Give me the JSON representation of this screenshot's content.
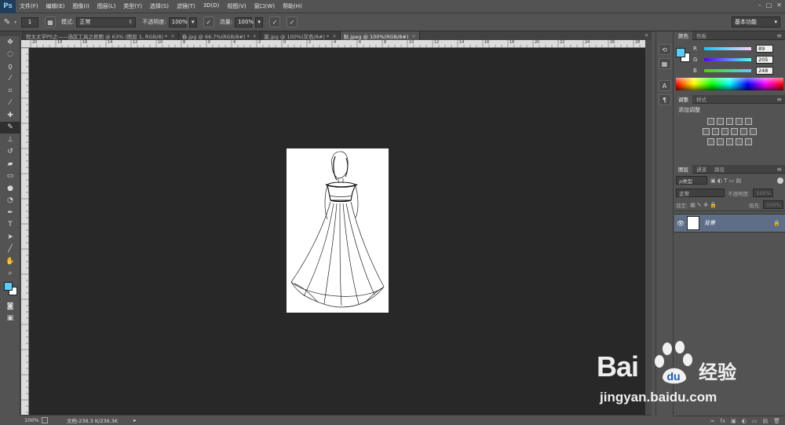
{
  "app": {
    "logo": "Ps"
  },
  "menu": [
    "文件(F)",
    "编辑(E)",
    "图像(I)",
    "图层(L)",
    "类型(Y)",
    "选择(S)",
    "滤镜(T)",
    "3D(D)",
    "视图(V)",
    "窗口(W)",
    "帮助(H)"
  ],
  "window_buttons": [
    "–",
    "□",
    "✕"
  ],
  "options": {
    "brush_size": "1",
    "mode_label": "模式:",
    "mode_value": "正常",
    "opacity_label": "不透明度:",
    "opacity_value": "100%",
    "flow_label": "流量:",
    "flow_value": "100%",
    "workspace": "基本功能"
  },
  "tabs": [
    {
      "label": "程太太学PS之——选区工具之抠图 @ 63% (图层 1, RGB/8) *",
      "close": "×"
    },
    {
      "label": "春.jpg @ 66.7%(RGB/8#) *",
      "close": "×"
    },
    {
      "label": "夏.jpg @ 100%(灰色/8#) *",
      "close": "×"
    },
    {
      "label": "秋.jpeg @ 100%(RGB/8#)",
      "close": "×"
    }
  ],
  "ruler_top_labels": [
    "20",
    "18",
    "16",
    "14",
    "12",
    "10",
    "8",
    "6",
    "4",
    "2",
    "0",
    "2",
    "4",
    "6",
    "8",
    "10",
    "12",
    "14",
    "16",
    "18",
    "20",
    "22",
    "24",
    "26",
    "28"
  ],
  "status": {
    "zoom": "100%",
    "doc": "文档:236.3 K/236.3K"
  },
  "color_panel": {
    "tabs": [
      "颜色",
      "色板"
    ],
    "sliders": [
      {
        "label": "R",
        "value": "89"
      },
      {
        "label": "G",
        "value": "205"
      },
      {
        "label": "B",
        "value": "248"
      }
    ],
    "foreground": "#59cdf8"
  },
  "adjust_panel": {
    "tabs": [
      "调整",
      "样式"
    ],
    "title": "添加调整"
  },
  "layers_panel": {
    "tabs": [
      "图层",
      "通道",
      "路径"
    ],
    "filter": "ρ类型",
    "blend": "正常",
    "opacity_label": "不透明度:",
    "opacity_value": "100%",
    "lock_label": "锁定:",
    "fill_label": "填充:",
    "fill_value": "100%",
    "layer_name": "背景"
  },
  "watermark": {
    "brand": "Bai",
    "brand2": "经验",
    "url": "jingyan.baidu.com"
  }
}
